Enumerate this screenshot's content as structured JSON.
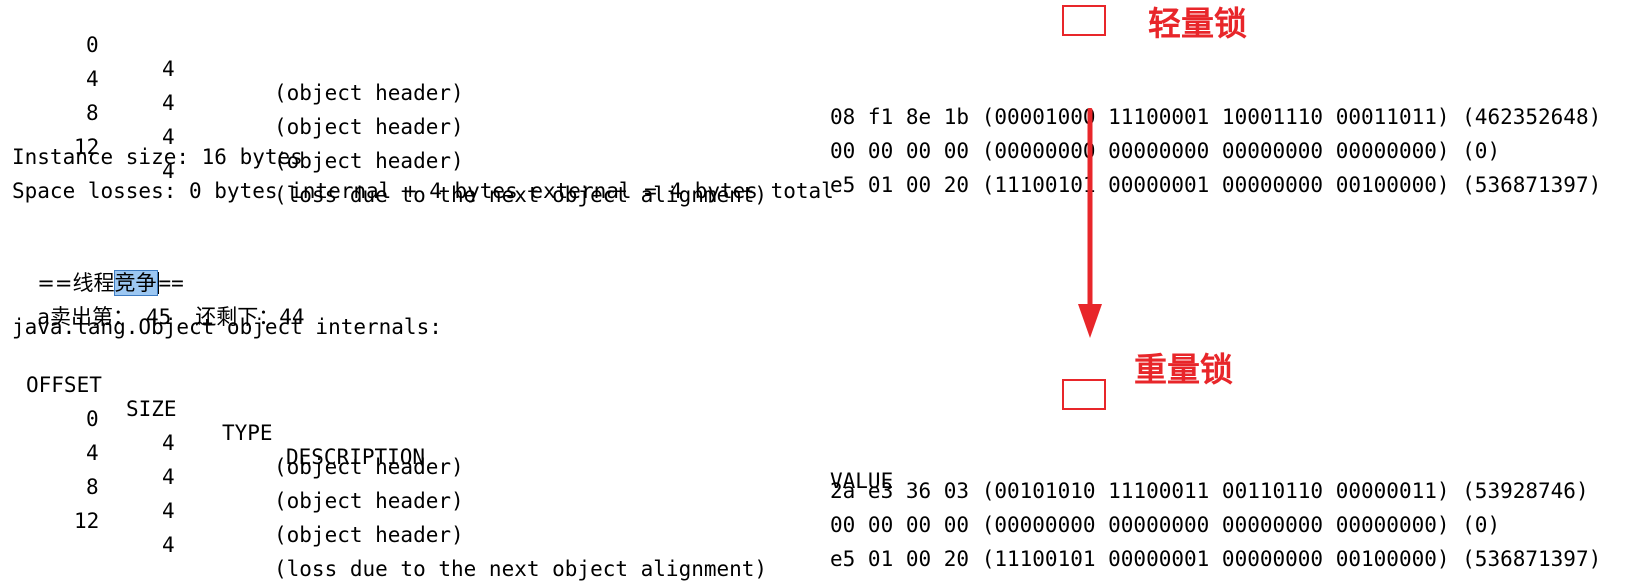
{
  "block1": {
    "rows": [
      {
        "offset": "0",
        "size": "4",
        "desc": "(object header)",
        "value": "08 f1 8e 1b (00001000 11100001 10001110 00011011) (462352648)"
      },
      {
        "offset": "4",
        "size": "4",
        "desc": "(object header)",
        "value": "00 00 00 00 (00000000 00000000 00000000 00000000) (0)"
      },
      {
        "offset": "8",
        "size": "4",
        "desc": "(object header)",
        "value": "e5 01 00 20 (11100101 00000001 00000000 00100000) (536871397)"
      },
      {
        "offset": "12",
        "size": "4",
        "desc": "(loss due to the next object alignment)",
        "value": ""
      }
    ],
    "instance_size": "Instance size: 16 bytes",
    "space_losses": "Space losses: 0 bytes internal + 4 bytes external = 4 bytes total"
  },
  "contention": {
    "prefix": "==线程",
    "selected": "竞争",
    "suffix": "=="
  },
  "sale": {
    "a": "a",
    "sold_label": "卖出第：",
    "sold_value": "45",
    "remain_label": "还剩下：",
    "remain_value": "44"
  },
  "object_internals": "java.lang.Object object internals:",
  "headers": {
    "offset": "OFFSET",
    "size": "SIZE",
    "type": "TYPE",
    "description": "DESCRIPTION",
    "value": "VALUE"
  },
  "block2": {
    "rows": [
      {
        "offset": "0",
        "size": "4",
        "desc": "(object header)",
        "value": "2a e3 36 03 (00101010 11100011 00110110 00000011) (53928746)"
      },
      {
        "offset": "4",
        "size": "4",
        "desc": "(object header)",
        "value": "00 00 00 00 (00000000 00000000 00000000 00000000) (0)"
      },
      {
        "offset": "8",
        "size": "4",
        "desc": "(object header)",
        "value": "e5 01 00 20 (11100101 00000001 00000000 00100000) (536871397)"
      },
      {
        "offset": "12",
        "size": "4",
        "desc": "(loss due to the next object alignment)",
        "value": ""
      }
    ]
  },
  "annotations": {
    "light_lock": "轻量锁",
    "heavy_lock": "重量锁",
    "color": "#e8262a",
    "selection_color": "#9cc7f2"
  }
}
